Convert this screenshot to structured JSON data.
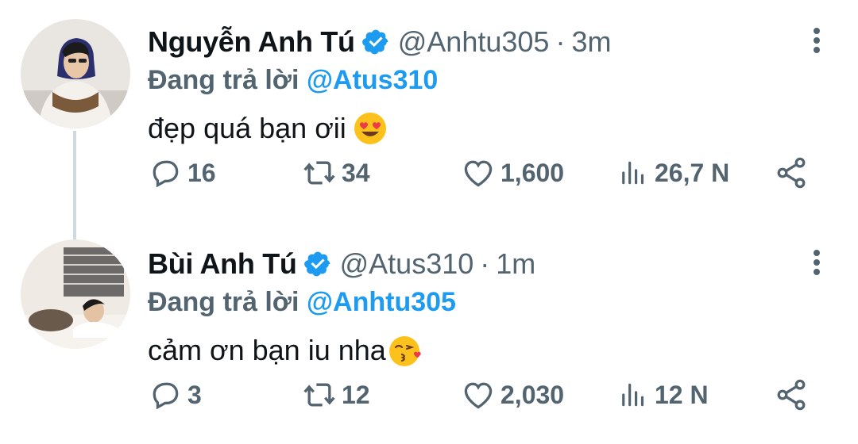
{
  "tweets": [
    {
      "name": "Nguyễn Anh Tú",
      "handle": "@Anhtu305",
      "separator": "·",
      "time": "3m",
      "reply_prefix": "Đang trả lời",
      "reply_to": "@Atus310",
      "text": "đẹp quá bạn ơii",
      "emoji": "heart-eyes-emoji",
      "stats": {
        "replies": "16",
        "retweets": "34",
        "likes": "1,600",
        "views": "26,7 N"
      }
    },
    {
      "name": "Bùi Anh Tú",
      "handle": "@Atus310",
      "separator": "·",
      "time": "1m",
      "reply_prefix": "Đang trả lời",
      "reply_to": "@Anhtu305",
      "text": "cảm ơn bạn iu nha",
      "emoji": "kissing-heart-emoji",
      "stats": {
        "replies": "3",
        "retweets": "12",
        "likes": "2,030",
        "views": "12 N"
      }
    }
  ],
  "colors": {
    "accent": "#1d9bf0",
    "text": "#0f1419",
    "secondary": "#536471",
    "thread": "#cfd9de"
  }
}
